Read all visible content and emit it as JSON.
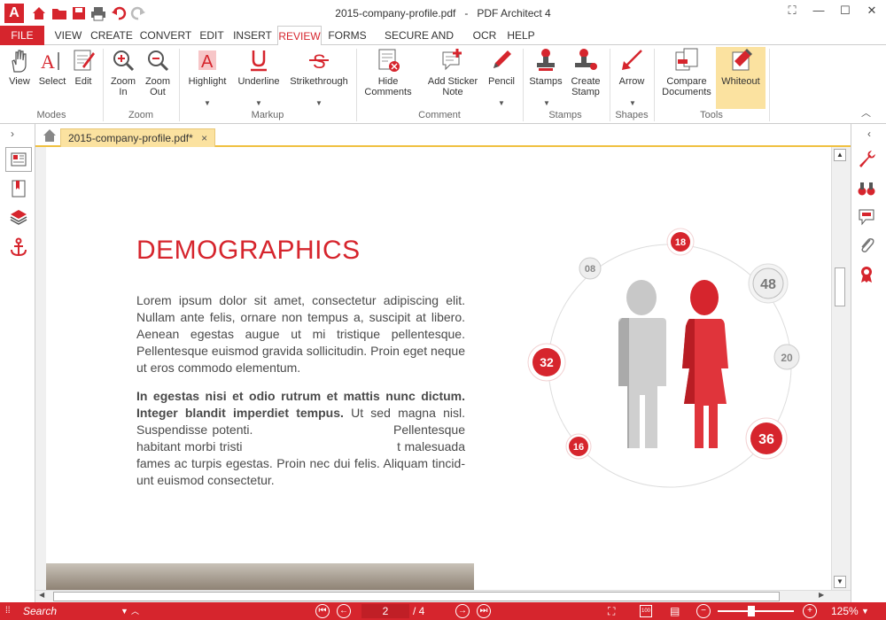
{
  "window": {
    "title": "2015-company-profile.pdf   -   PDF Architect 4"
  },
  "menus": [
    "FILE",
    "VIEW",
    "CREATE",
    "CONVERT",
    "EDIT",
    "INSERT",
    "REVIEW",
    "FORMS",
    "SECURE AND SIGN",
    "OCR",
    "HELP"
  ],
  "active_menu": "REVIEW",
  "ribbon": {
    "view": "View",
    "select": "Select",
    "edit": "Edit",
    "zoom_in_1": "Zoom",
    "zoom_in_2": "In",
    "zoom_out_1": "Zoom",
    "zoom_out_2": "Out",
    "highlight": "Highlight",
    "underline": "Underline",
    "strikethrough": "Strikethrough",
    "hide_comments_1": "Hide",
    "hide_comments_2": "Comments",
    "sticker_1": "Add Sticker",
    "sticker_2": "Note",
    "pencil": "Pencil",
    "stamps": "Stamps",
    "create_stamp_1": "Create",
    "create_stamp_2": "Stamp",
    "arrow": "Arrow",
    "compare_1": "Compare",
    "compare_2": "Documents",
    "whiteout": "Whiteout",
    "groups": {
      "modes": "Modes",
      "zoom": "Zoom",
      "markup": "Markup",
      "comment": "Comment",
      "stamps": "Stamps",
      "shapes": "Shapes",
      "tools": "Tools"
    }
  },
  "tab": {
    "label": "2015-company-profile.pdf*",
    "close": "×"
  },
  "document": {
    "heading": "DEMOGRAPHICS",
    "para1": "Lorem ipsum dolor sit amet, consectetur adipiscing elit. Nullam ante felis, ornare non tempus a, suscipit at libero. Aenean egestas augue ut mi tristique pellentesque. Pellentesque euismod gravida sollicitudin. Proin eget neque ut eros commodo elementum.",
    "para2_bold": "In egestas nisi et odio rutrum et mattis nunc dictum. Integer blandit imperdiet tempus.",
    "para2_rest": " Ut sed magna nisl. Suspendisse potenti.                              Pellentesque habitant morbi tristi                                       t malesuada fames ac turpis egestas. Proin nec dui felis. Aliquam tincid­unt euismod consectetur.",
    "bubbles": [
      "18",
      "08",
      "48",
      "32",
      "20",
      "16",
      "36"
    ]
  },
  "status": {
    "search_placeholder": "Search",
    "page_current": "2",
    "page_total": "/ 4",
    "zoom": "125%"
  },
  "colors": {
    "brand_red": "#d6252d",
    "active_tool": "#fbe2a0",
    "tab_accent": "#f0c040"
  }
}
